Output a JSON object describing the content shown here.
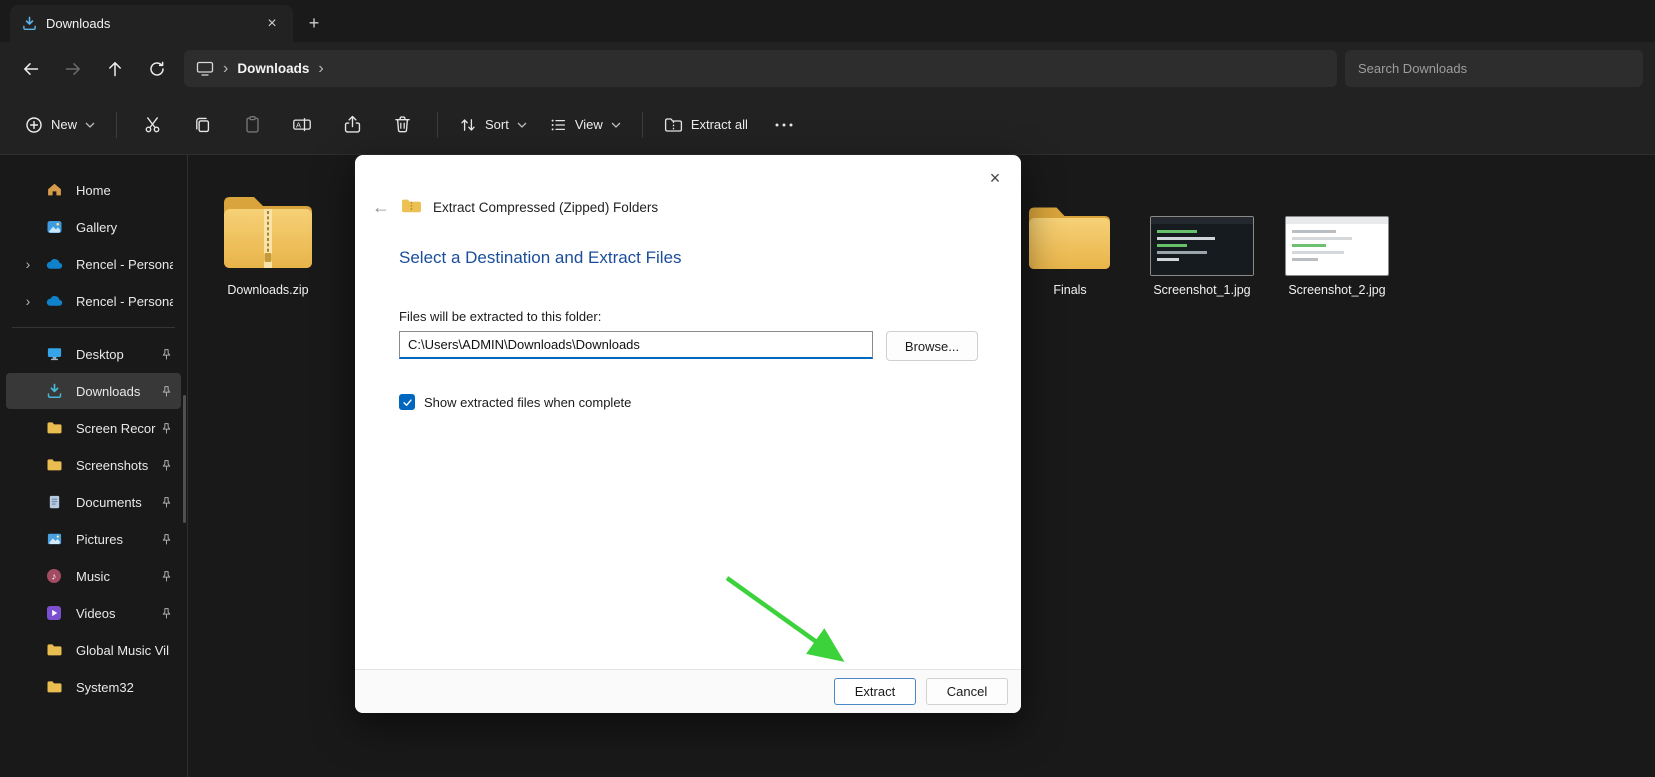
{
  "icons": {
    "close": "×",
    "new_tab": "+",
    "chevron_right": "›",
    "back_arrow": "←"
  },
  "titlebar": {
    "tab_title": "Downloads"
  },
  "navbar": {
    "breadcrumb_item": "Downloads",
    "search_placeholder": "Search Downloads"
  },
  "toolbar": {
    "new_label": "New",
    "sort_label": "Sort",
    "view_label": "View",
    "extract_all_label": "Extract all"
  },
  "sidebar": {
    "items": [
      {
        "label": "Home"
      },
      {
        "label": "Gallery"
      },
      {
        "label": "Rencel - Persona"
      },
      {
        "label": "Rencel - Persona"
      },
      {
        "label": "Desktop"
      },
      {
        "label": "Downloads"
      },
      {
        "label": "Screen Recor"
      },
      {
        "label": "Screenshots"
      },
      {
        "label": "Documents"
      },
      {
        "label": "Pictures"
      },
      {
        "label": "Music"
      },
      {
        "label": "Videos"
      },
      {
        "label": "Global Music Vil"
      },
      {
        "label": "System32"
      }
    ]
  },
  "files": {
    "items": [
      {
        "name": "Downloads.zip"
      },
      {
        "name": "Finals"
      },
      {
        "name": "Screenshot_1.jpg"
      },
      {
        "name": "Screenshot_2.jpg"
      }
    ]
  },
  "dialog": {
    "title": "Extract Compressed (Zipped) Folders",
    "heading": "Select a Destination and Extract Files",
    "files_label": "Files will be extracted to this folder:",
    "path_value": "C:\\Users\\ADMIN\\Downloads\\Downloads",
    "browse_label": "Browse...",
    "checkbox_label": "Show extracted files when complete",
    "extract_label": "Extract",
    "cancel_label": "Cancel"
  },
  "colors": {
    "accent_blue": "#0067c0",
    "heading_blue": "#1a4d9a",
    "folder_yellow": "#ecc052",
    "annotation_green": "#3bd23b"
  }
}
